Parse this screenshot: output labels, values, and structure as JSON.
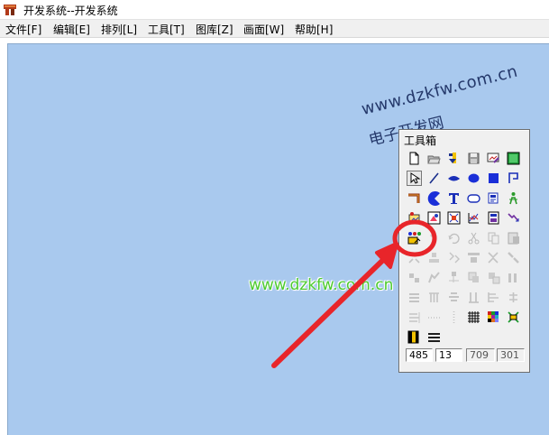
{
  "window": {
    "title": "开发系统--开发系统"
  },
  "menu": [
    {
      "label": "文件[F]"
    },
    {
      "label": "编辑[E]"
    },
    {
      "label": "排列[L]"
    },
    {
      "label": "工具[T]"
    },
    {
      "label": "图库[Z]"
    },
    {
      "label": "画面[W]"
    },
    {
      "label": "帮助[H]"
    }
  ],
  "watermarks": {
    "url": "www.dzkfw.com.cn",
    "site_name": "电子开发网",
    "green_url": "www.dzkfw.com.cn"
  },
  "toolbox": {
    "title": "工具箱",
    "status": [
      "485",
      "13",
      "709",
      "301"
    ]
  },
  "colors": {
    "canvas": "#a9c9ee",
    "annotation": "#e8252a",
    "green_watermark": "#4ccb2e"
  }
}
